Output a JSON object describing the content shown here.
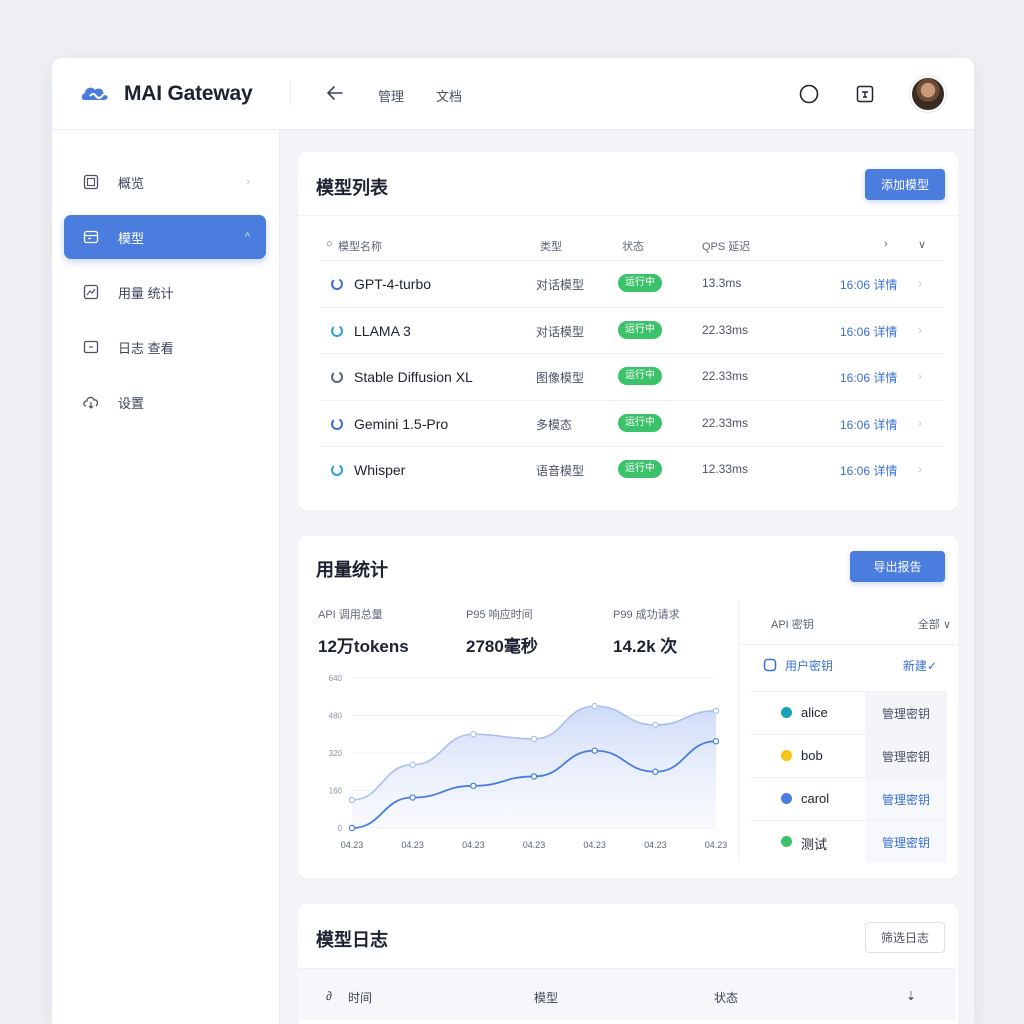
{
  "app": {
    "title": "MAI Gateway"
  },
  "topbar": {
    "nav": [
      "管理",
      "文档"
    ]
  },
  "sidebar": {
    "items": [
      {
        "label": "概览",
        "icon": "grid-icon",
        "active": false
      },
      {
        "label": "模型",
        "icon": "model-icon",
        "active": true
      },
      {
        "label": "用量 统计",
        "icon": "chart-icon",
        "active": false
      },
      {
        "label": "日志 查看",
        "icon": "log-icon",
        "active": false
      },
      {
        "label": "设置",
        "icon": "cloud-icon",
        "active": false
      }
    ]
  },
  "models": {
    "title": "模型列表",
    "add_label": "添加模型",
    "columns": [
      "模型名称",
      "类型",
      "状态",
      "QPS 延迟"
    ],
    "rows": [
      {
        "name": "GPT-4-turbo",
        "type": "对话模型",
        "status": "运行中",
        "latency": "13.3ms",
        "link": "16:06 详情",
        "icon_color": "#3a6fd8"
      },
      {
        "name": "LLAMA 3",
        "type": "对话模型",
        "status": "运行中",
        "latency": "22.33ms",
        "link": "16:06 详情",
        "icon_color": "#2f9fd8"
      },
      {
        "name": "Stable Diffusion XL",
        "type": "图像模型",
        "status": "运行中",
        "latency": "22.33ms",
        "link": "16:06 详情",
        "icon_color": "#5d6578"
      },
      {
        "name": "Gemini 1.5-Pro",
        "type": "多模态",
        "status": "运行中",
        "latency": "22.33ms",
        "link": "16:06 详情",
        "icon_color": "#3a6fd8"
      },
      {
        "name": "Whisper",
        "type": "语音模型",
        "status": "运行中",
        "latency": "12.33ms",
        "link": "16:06 详情",
        "icon_color": "#2f9fd8"
      }
    ]
  },
  "usage": {
    "title": "用量统计",
    "export_label": "导出报告",
    "stats": [
      {
        "label": "API 调用总量",
        "value": "12万tokens"
      },
      {
        "label": "P95 响应时间",
        "value": "2780毫秒"
      },
      {
        "label": "P99 成功请求",
        "value": "14.2k 次"
      }
    ],
    "panel": {
      "head_left": "API 密钥",
      "head_right": "全部",
      "sub_left": "用户密钥",
      "sub_right": "新建",
      "users": [
        {
          "name": "alice",
          "action": "管理密钥",
          "color": "#17a2b8",
          "link": false
        },
        {
          "name": "bob",
          "action": "管理密钥",
          "color": "#f5c518",
          "link": false
        },
        {
          "name": "carol",
          "action": "管理密钥",
          "color": "#4a7ddd",
          "link": true
        },
        {
          "name": "测试",
          "action": "管理密钥",
          "color": "#3cc26a",
          "link": true
        }
      ]
    }
  },
  "chart_data": {
    "type": "area",
    "x": [
      "04.23",
      "04.23",
      "04.23",
      "04.23",
      "04.23",
      "04.23",
      "04.23"
    ],
    "ylim": [
      0,
      640
    ],
    "yticks": [
      0,
      160,
      320,
      480,
      640
    ],
    "series": [
      {
        "values": [
          120,
          270,
          400,
          380,
          520,
          440,
          500
        ]
      },
      {
        "values": [
          0,
          130,
          180,
          220,
          330,
          240,
          370
        ]
      }
    ],
    "colors": [
      "#a9bff0",
      "#4a7ddd"
    ]
  },
  "logs": {
    "title": "模型日志",
    "filter_label": "筛选日志",
    "columns": [
      "时间",
      "模型",
      "状态"
    ]
  },
  "colors": {
    "accent": "#4a7ddd",
    "success": "#3cc26a",
    "background": "#eef0f4"
  }
}
